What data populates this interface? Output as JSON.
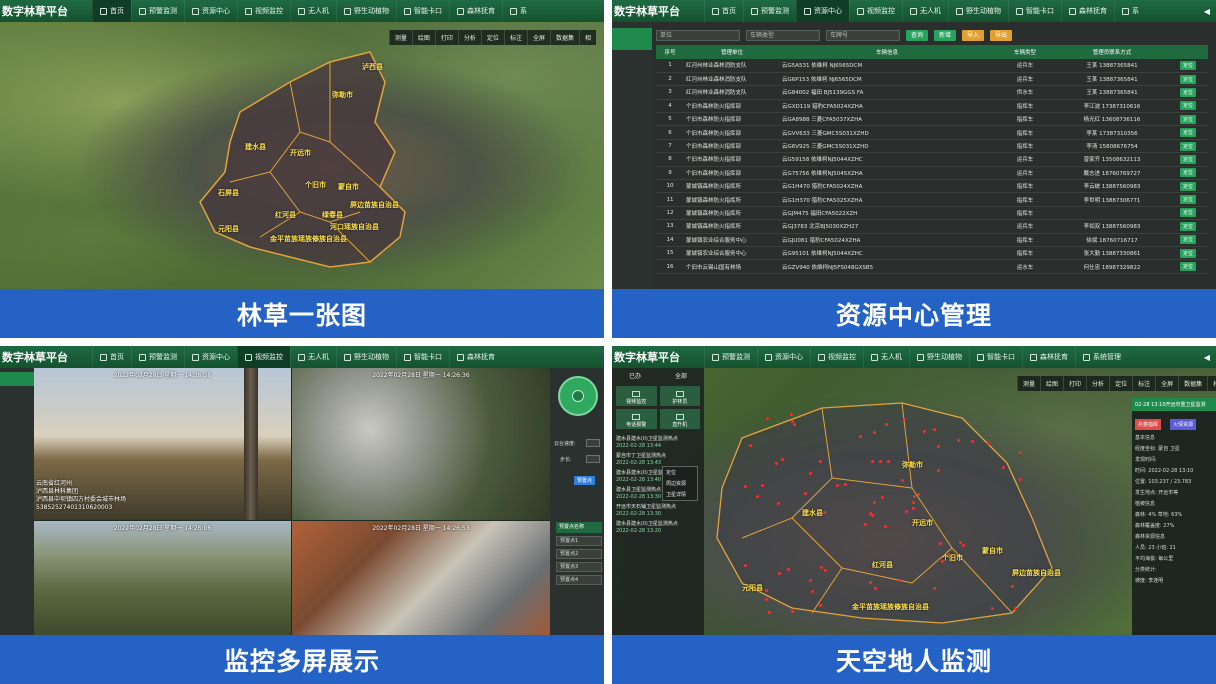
{
  "app": {
    "brand": "数字林草平台",
    "nav": [
      "首页",
      "预警监测",
      "资源中心",
      "视频监控",
      "无人机",
      "野生动植物",
      "智能卡口",
      "森林抚育",
      "系统管理"
    ],
    "nav_short_tail": "系"
  },
  "captions": {
    "q1": "林草一张图",
    "q2": "资源中心管理",
    "q3": "监控多屏展示",
    "q4": "天空地人监测"
  },
  "map_tools": [
    "测量",
    "绘图",
    "打印",
    "分析",
    "定位",
    "标注",
    "全屏",
    "数据集",
    "相"
  ],
  "map_tools_q4": [
    "测量",
    "绘图",
    "打印",
    "分析",
    "定位",
    "标注",
    "全屏",
    "数据集",
    "相"
  ],
  "resource": {
    "filter_unit_placeholder": "单位",
    "filter_type_placeholder": "车辆类型",
    "filter_plate_placeholder": "车牌号",
    "btn_query": "查询",
    "btn_add": "新增",
    "btn_import": "导入",
    "btn_export": "导出",
    "columns": [
      "序号",
      "管理单位",
      "车辆信息",
      "车辆类型",
      "管理员联系方式"
    ],
    "rows": [
      [
        "1",
        "红河州林业森林消防支队",
        "云G5A531 依维柯 NJ6565DCM",
        "运兵车",
        "王某 13887365841"
      ],
      [
        "2",
        "红河州林业森林消防支队",
        "云G6P153 依维柯 NJ6565DCM",
        "运兵车",
        "王某 13887365841"
      ],
      [
        "3",
        "红河州林业森林消防支队",
        "云G84002 福田 BJ5139GGS FA",
        "供水车",
        "王某 13887365841"
      ],
      [
        "4",
        "个旧市森林防火指挥部",
        "云GXD119 猎豹CFA5024XZHA",
        "指挥车",
        "李江波 17387310616"
      ],
      [
        "5",
        "个旧市森林防火指挥部",
        "云GA8988 三菱CFA5037XZHA",
        "指挥车",
        "杨光红 13608736116"
      ],
      [
        "6",
        "个旧市森林防火指挥部",
        "云GVV633 三菱GMC5S031XZHD",
        "指挥车",
        "李某 17387310356"
      ],
      [
        "7",
        "个旧市森林防火指挥部",
        "云G6V925 三菱GMC5S031XZHD",
        "指挥车",
        "李清 15808676754"
      ],
      [
        "8",
        "个旧市森林防火指挥部",
        "云G59158 依维柯NJ5044XZHC",
        "运兵车",
        "曾家齐 13508632113"
      ],
      [
        "9",
        "个旧市森林防火指挥部",
        "云G75756 依维柯NJ5045XZHA",
        "运兵车",
        "戴志进 18760769727"
      ],
      [
        "10",
        "蒙城镇森林防火指挥所",
        "云G1H470 猎豹CFA5024XZHA",
        "指挥车",
        "李云统 13887560983"
      ],
      [
        "11",
        "蒙城镇森林防火指挥所",
        "云G1H370 猎豹CFA5025XZHA",
        "指挥车",
        "李世明 13887306771"
      ],
      [
        "12",
        "蒙城镇森林防火指挥所",
        "云GJM475 福田CFA5022XZH",
        "指挥车",
        ""
      ],
      [
        "13",
        "蒙城镇森林防火指挥所",
        "云GJ3783 北京BJ5030XZH27",
        "运兵车",
        "李如双 13887560983"
      ],
      [
        "14",
        "蒙城镇农业综合服务中心",
        "云GJU081 猎豹CFA5024XZHA",
        "指挥车",
        "徐斌 18760716717"
      ],
      [
        "15",
        "蒙城镇农业综合服务中心",
        "云G95101 依维柯NJ5044XZHC",
        "指挥车",
        "张大勤 13887330861"
      ],
      [
        "16",
        "个旧市云锡山国有林场",
        "云GZV940 依维柯NJ5FS048GXSB5",
        "运水车",
        "何仕忠 18987329822"
      ]
    ],
    "op_label": "定位"
  },
  "video": {
    "cams": [
      {
        "ts": "2022年02月28日 星期一 14:26:36",
        "loc": "云南省红河州\n泸西县林科集团\n泸西县中坝镇四方村委会城市林场\n53852527401310620003"
      },
      {
        "ts": "2022年02月28日 星期一 14:26:36",
        "loc": ""
      },
      {
        "ts": "2022年02月28日 星期一 14:26:06",
        "loc": ""
      },
      {
        "ts": "2022年02月28日 星期一 14:26:53",
        "loc": ""
      }
    ],
    "speed_label": "云台速度:",
    "step_label": "步长:",
    "preset_btn": "预置点",
    "preset_head": "预置点名称",
    "presets": [
      "预置点1",
      "预置点2",
      "预置点3",
      "预置点4"
    ]
  },
  "monitor": {
    "tabs": [
      "已办",
      "全部"
    ],
    "icons": [
      "视频监控",
      "护林员",
      "电话报警",
      "直升机"
    ],
    "alerts": [
      {
        "title": "建水县建水(II)卫星监测热点",
        "time": "2022-02-28 13:44"
      },
      {
        "title": "蒙自市丁卫星监测热点",
        "time": "2022-02-28 13:43"
      },
      {
        "title": "建水县建水(II)卫星监测热点",
        "time": "2022-02-28 13:40"
      },
      {
        "title": "建水县卫星监测热点",
        "time": "2022-02-28 13:30"
      },
      {
        "title": "开远市天石铺卫星监测热点",
        "time": "2022-02-28 13:30"
      },
      {
        "title": "建水县建水(II)卫星监测热点",
        "time": "2022-02-28 13:20"
      }
    ],
    "ctx": [
      "定位",
      "周边资源",
      "卫星详情"
    ],
    "rp_title": "02-28 13:10开远市重卫星监测",
    "rp_btn_fire": "扑救指挥",
    "rp_btn_resource": "火情资源",
    "rp_rows": [
      "基本信息",
      "经度坐标: 蒙自 卫星",
      "发现时间:",
      "时间: 2022-02-28 13:10",
      "位置: 103.237 / 23.783",
      "发生地点: 开远市等",
      "植被信息",
      "森林: 4%  草地: 63%",
      "森林覆盖度: 27%",
      "森林资源信息",
      "人员: 23  小班: 21",
      "平均海拔: 每公里",
      "分类统计:",
      "坡度: 李连明"
    ]
  },
  "map_labels": [
    "泸西县",
    "弥勒市",
    "开远市",
    "个旧市",
    "蒙自市",
    "建水县",
    "石屏县",
    "红河县",
    "元阳县",
    "绿春县",
    "金平苗族瑶族傣族自治县",
    "河口瑶族自治县",
    "屏边苗族自治县"
  ],
  "map_labels_q4": [
    "弥勒市",
    "开远市",
    "个旧市",
    "蒙自市",
    "建水县",
    "红河县",
    "元阳县",
    "屏边苗族自治县",
    "金平苗族瑶族傣族自治县"
  ]
}
